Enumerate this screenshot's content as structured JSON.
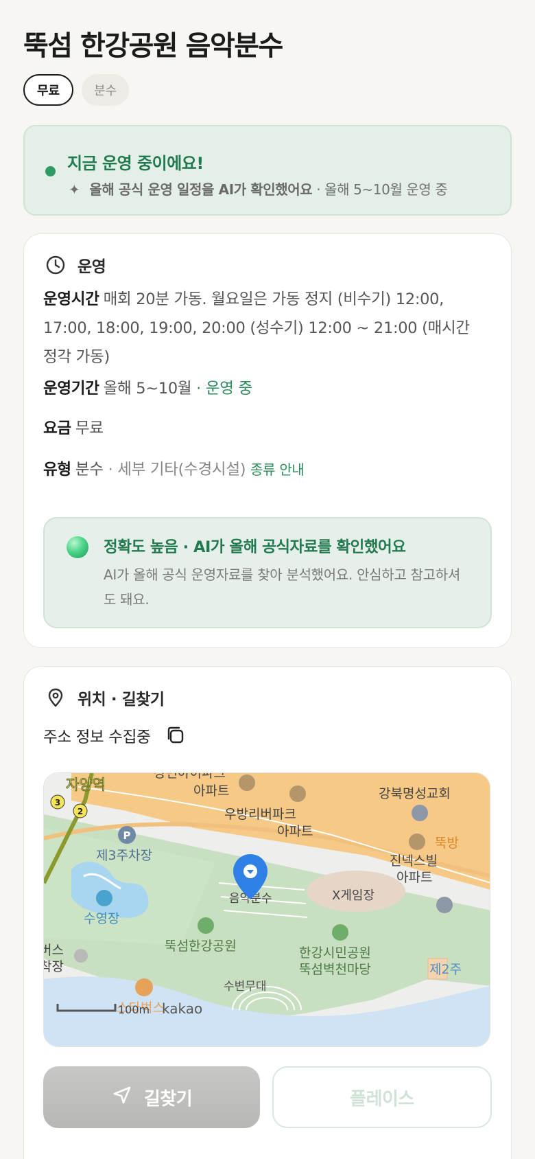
{
  "title": "뚝섬 한강공원 음악분수",
  "chips": [
    "무료",
    "분수"
  ],
  "status": {
    "title": "지금 운영 중이에요!",
    "ai_note": "올해 공식 운영 일정을 AI가 확인했어요",
    "separator": " · ",
    "period": "올해 5~10월 운영 중"
  },
  "operation": {
    "section_label": "운영",
    "hours_key": "운영시간",
    "hours_value": "매회 20분 가동. 월요일은 가동 정지 (비수기) 12:00, 17:00, 18:00, 19:00, 20:00 (성수기) 12:00 ~ 21:00 (매시간 정각 가동)",
    "period_key": "운영기간",
    "period_value": "올해 5~10월",
    "period_sep": " · ",
    "period_status": "운영 중",
    "fee_key": "요금",
    "fee_value": "무료",
    "type_key": "유형",
    "type_value": "분수",
    "type_sep": " · ",
    "type_detail": "세부 기타(수경시설)",
    "type_link": "종류 안내",
    "accuracy_title": "정확도 높음 · AI가 올해 공식자료를 확인했어요",
    "accuracy_desc": "AI가 올해 공식 운영자료를 찾아 분석했어요. 안심하고 참고하셔도 돼요."
  },
  "location": {
    "section_label": "위치 · 길찾기",
    "address": "주소 정보 수집중",
    "map_labels": {
      "station": "자양역",
      "line3": "3",
      "line2": "2",
      "apt1a": "장변아이파크",
      "apt1b": "아파트",
      "apt2a": "우방리버파크",
      "apt2b": "아파트",
      "church": "강북명성교회",
      "ttuk": "뚝방",
      "apt3a": "진넥스빌",
      "apt3b": "아파트",
      "parking_p": "P",
      "parking": "제3주차장",
      "pool": "수영장",
      "fountain": "음악분수",
      "xgame": "X게임장",
      "park": "뚝섬한강공원",
      "citizen1": "한강시민공원",
      "citizen2": "뚝섬벽천마당",
      "bus1": "버스",
      "bus2": "착장",
      "stage": "수변무대",
      "starbucks": "스타벅스",
      "scale": "100m",
      "brand": "kakao",
      "second": "제2주"
    },
    "route_button": "길찾기",
    "place_button": "플레이스"
  }
}
